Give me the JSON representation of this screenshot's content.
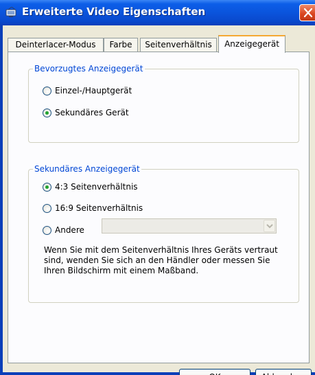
{
  "window": {
    "title": "Erweiterte Video Eigenschaften"
  },
  "tabs": [
    {
      "label": "Deinterlacer-Modus",
      "active": false
    },
    {
      "label": "Farbe",
      "active": false
    },
    {
      "label": "Seitenverhältnis",
      "active": false
    },
    {
      "label": "Anzeigegerät",
      "active": true
    }
  ],
  "preferred_group": {
    "legend": "Bevorzugtes Anzeigegerät",
    "options": [
      {
        "label": "Einzel-/Hauptgerät",
        "checked": false
      },
      {
        "label": "Sekundäres Gerät",
        "checked": true
      }
    ]
  },
  "secondary_group": {
    "legend": "Sekundäres Anzeigegerät",
    "options": [
      {
        "label": "4:3 Seitenverhältnis",
        "checked": true
      },
      {
        "label": "16:9 Seitenverhältnis",
        "checked": false
      },
      {
        "label": "Andere",
        "checked": false
      }
    ],
    "other_select_value": "",
    "info_text": "Wenn Sie mit dem Seitenverhältnis Ihres Geräts vertraut sind, wenden Sie sich an den Händler oder messen Sie Ihren Bildschirm mit einem Maßband."
  },
  "buttons": {
    "ok": "OK",
    "cancel": "Abbrechen"
  },
  "colors": {
    "title_bar": "#0a54dc",
    "group_legend": "#0046d5",
    "radio_dot": "#22a32e",
    "active_tab_accent": "#f5a832",
    "close_button": "#d9441e"
  },
  "icons": {
    "title": "video-display-icon",
    "close": "close-icon",
    "dropdown": "chevron-down-icon"
  }
}
